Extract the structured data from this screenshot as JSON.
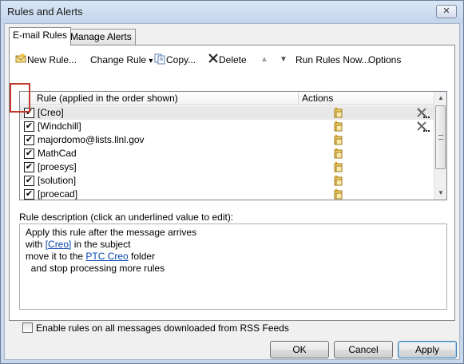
{
  "window": {
    "title": "Rules and Alerts",
    "close_label": "✕"
  },
  "tabs": [
    {
      "label": "E-mail Rules",
      "active": true
    },
    {
      "label": "Manage Alerts",
      "active": false
    }
  ],
  "toolbar": {
    "new_rule": "New Rule...",
    "change_rule": "Change Rule",
    "change_rule_arrow": "▾",
    "copy": "Copy...",
    "delete": "Delete",
    "move_up": "▲",
    "move_down": "▼",
    "run_rules_now": "Run Rules Now...",
    "options": "Options"
  },
  "rules_list": {
    "col_rule_header": "Rule (applied in the order shown)",
    "col_actions_header": "Actions",
    "rows": [
      {
        "name": "[Creo]",
        "checked": true,
        "selected": true,
        "has_client_only_icon": true
      },
      {
        "name": "[Windchill]",
        "checked": true,
        "selected": false,
        "has_client_only_icon": true
      },
      {
        "name": "majordomo@lists.llnl.gov",
        "checked": true,
        "selected": false,
        "has_client_only_icon": false
      },
      {
        "name": "MathCad",
        "checked": true,
        "selected": false,
        "has_client_only_icon": false
      },
      {
        "name": "[proesys]",
        "checked": true,
        "selected": false,
        "has_client_only_icon": false
      },
      {
        "name": "[solution]",
        "checked": true,
        "selected": false,
        "has_client_only_icon": false
      },
      {
        "name": "[proecad]",
        "checked": true,
        "selected": false,
        "has_client_only_icon": false
      }
    ],
    "check_glyph": "✔"
  },
  "description": {
    "label": "Rule description (click an underlined value to edit):",
    "line1": "Apply this rule after the message arrives",
    "line2_pre": "with ",
    "line2_link": "[Creo]",
    "line2_post": " in the subject",
    "line3_pre": "move it to the ",
    "line3_link": "PTC Creo",
    "line3_post": " folder",
    "line4": "  and stop processing more rules"
  },
  "rss_checkbox": {
    "label": "Enable rules on all messages downloaded from RSS Feeds",
    "checked": false
  },
  "buttons": {
    "ok": "OK",
    "cancel": "Cancel",
    "apply": "Apply"
  },
  "colors": {
    "link": "#0645ad",
    "highlight_box": "#c0392b",
    "selected_row": "#e8e8e8"
  }
}
